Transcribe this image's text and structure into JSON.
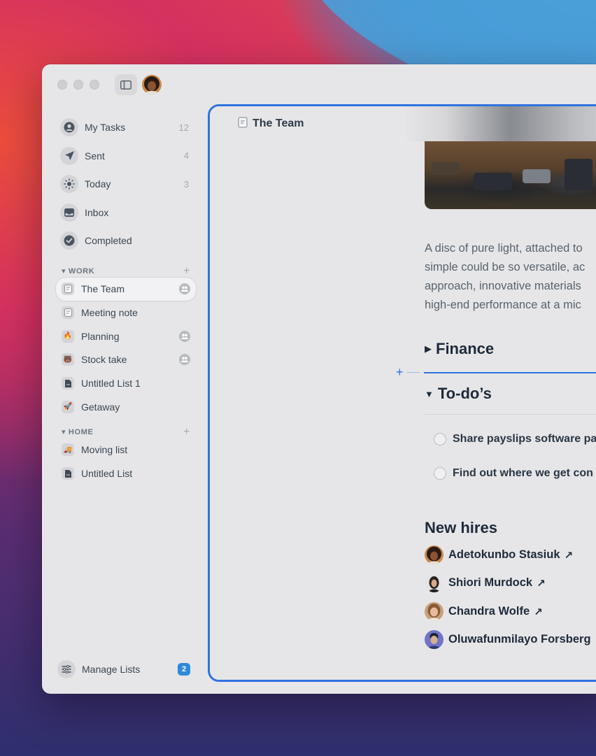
{
  "sidebar": {
    "items": [
      {
        "label": "My Tasks",
        "count": "12",
        "icon": "person-icon"
      },
      {
        "label": "Sent",
        "count": "4",
        "icon": "paper-plane-icon"
      },
      {
        "label": "Today",
        "count": "3",
        "icon": "sun-icon"
      },
      {
        "label": "Inbox",
        "count": "",
        "icon": "inbox-tray-icon"
      },
      {
        "label": "Completed",
        "count": "",
        "icon": "checkmark-icon"
      }
    ],
    "work": {
      "heading": "WORK",
      "lists": [
        {
          "label": "The Team",
          "icon": "note-icon",
          "shared": true
        },
        {
          "label": "Meeting note",
          "icon": "note-icon",
          "shared": false
        },
        {
          "label": "Planning",
          "icon": "fire-emoji",
          "shared": true
        },
        {
          "label": "Stock take",
          "icon": "bear-emoji",
          "shared": true
        },
        {
          "label": "Untitled List 1",
          "icon": "document-icon",
          "shared": false
        },
        {
          "label": "Getaway",
          "icon": "rocket-emoji",
          "shared": false
        }
      ]
    },
    "home": {
      "heading": "HOME",
      "lists": [
        {
          "label": "Moving list",
          "icon": "truck-emoji"
        },
        {
          "label": "Untitled List",
          "icon": "document-icon"
        }
      ]
    },
    "manage": {
      "label": "Manage Lists",
      "badge": "2"
    }
  },
  "main": {
    "title": "The Team",
    "paragraph": [
      "A disc of pure light, attached to",
      "simple could be so versatile, ac",
      "approach, innovative materials",
      "high-end performance at a mic"
    ],
    "finance_heading": "Finance",
    "todos_heading": "To-do’s",
    "tasks": [
      "Share payslips software pa",
      "Find out where we get con"
    ],
    "new_hires_heading": "New hires",
    "people": [
      "Adetokunbo Stasiuk",
      "Shiori Murdock",
      "Chandra Wolfe",
      "Oluwafunmilayo Forsberg"
    ]
  },
  "colors": {
    "accent": "#2e73e0",
    "badge": "#2f8ad8"
  }
}
